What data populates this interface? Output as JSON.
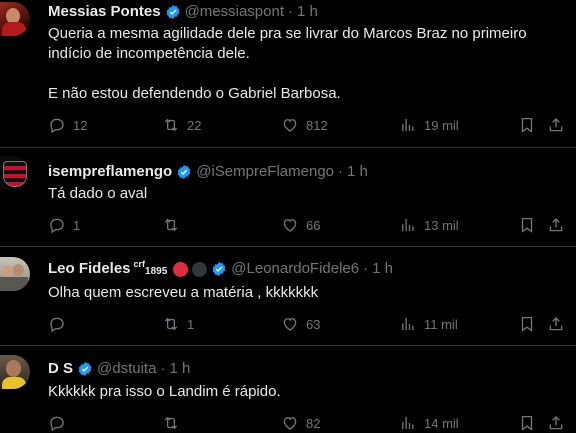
{
  "tweets": [
    {
      "name": "Messias Pontes",
      "handle": "@messiaspont",
      "time": "1 h",
      "text": "Queria a mesma agilidade dele pra se livrar do Marcos Braz no primeiro indício de incompetência dele.\n\nE não estou defendendo o Gabriel Barbosa.",
      "replies": "12",
      "retweets": "22",
      "likes": "812",
      "views": "19 mil"
    },
    {
      "name": "isempreflamengo",
      "handle": "@iSempreFlamengo",
      "time": "1 h",
      "text": "Tá dado o aval",
      "replies": "1",
      "retweets": "",
      "likes": "66",
      "views": "13 mil"
    },
    {
      "name": "Leo Fideles",
      "name_sup": "crf",
      "name_sub": "1895",
      "handle": "@LeonardoFidele6",
      "time": "1 h",
      "text": "Olha quem escreveu a matéria , kkkkkkk",
      "replies": "",
      "retweets": "1",
      "likes": "63",
      "views": "11 mil"
    },
    {
      "name": "D S",
      "handle": "@dstuita",
      "time": "1 h",
      "text": "Kkkkkk pra isso o Landim é rápido.",
      "replies": "",
      "retweets": "",
      "likes": "82",
      "views": "14 mil"
    }
  ],
  "colors": {
    "background": "#000000",
    "text": "#e7e9ea",
    "muted": "#71767b",
    "verified": "#1d9bf0",
    "divider": "#2f3336"
  }
}
